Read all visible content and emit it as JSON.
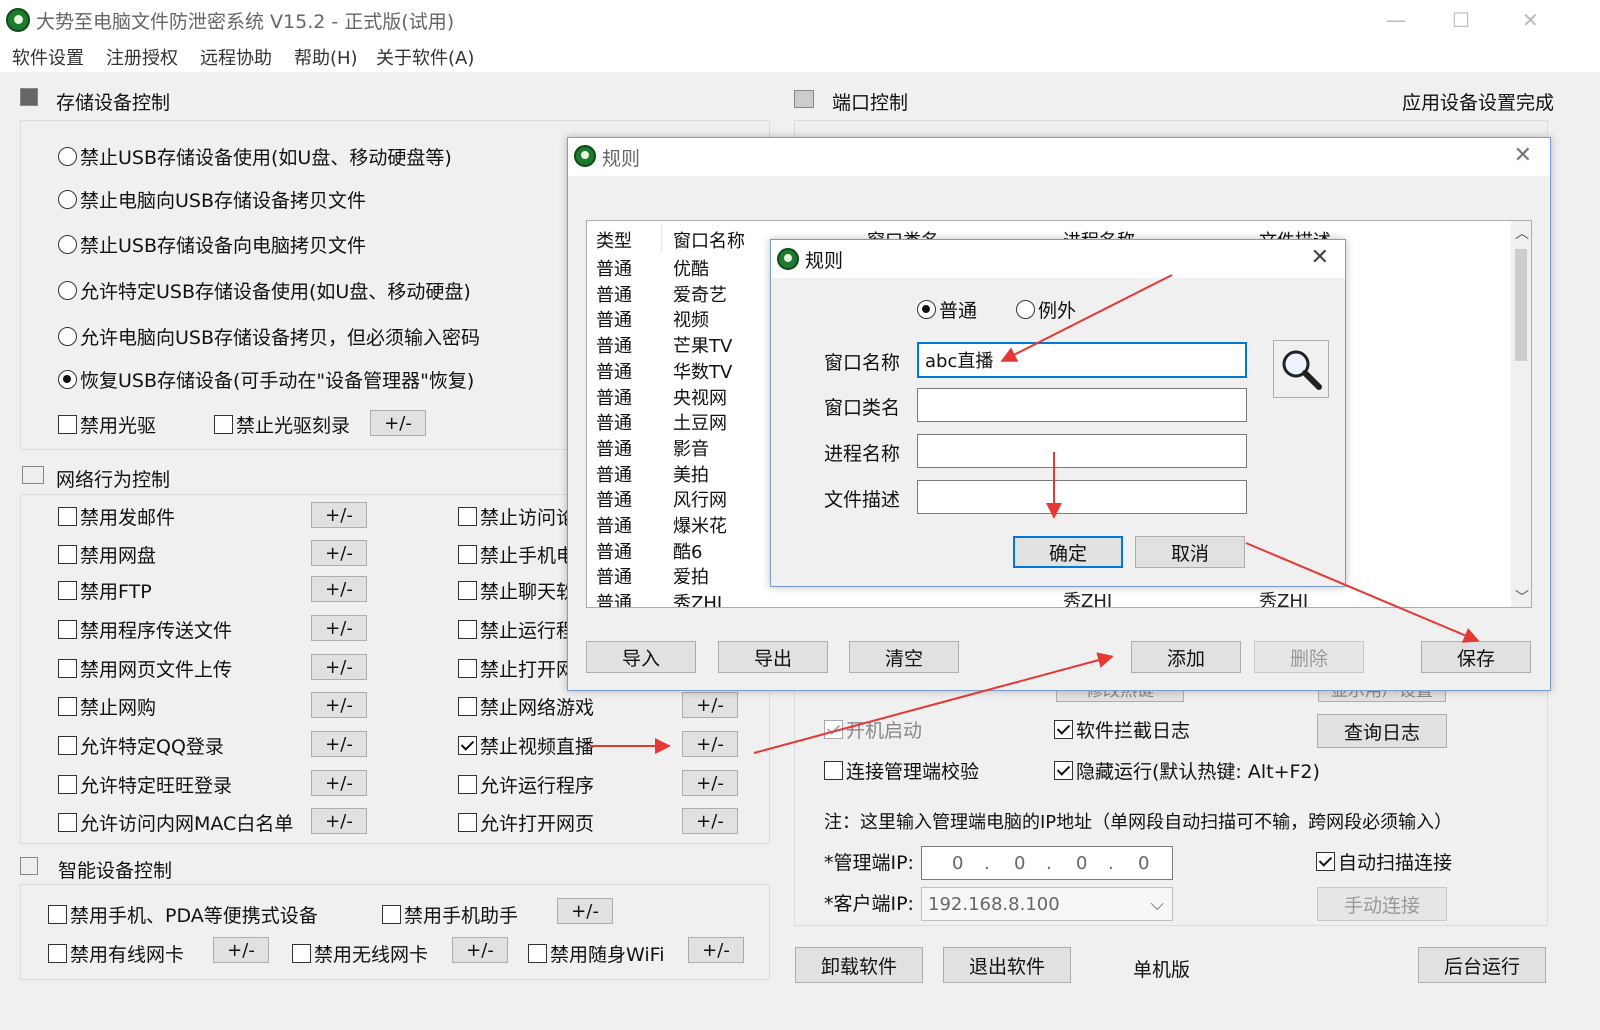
{
  "window": {
    "title": "大势至电脑文件防泄密系统 V15.2 - 正式版(试用)",
    "minimize": "—",
    "maximize": "☐",
    "close": "✕"
  },
  "menu": [
    "软件设置",
    "注册授权",
    "远程协助",
    "帮助(H)",
    "关于软件(A)"
  ],
  "storage": {
    "title": "存储设备控制",
    "options": [
      "禁止USB存储设备使用(如U盘、移动硬盘等)",
      "禁止电脑向USB存储设备拷贝文件",
      "禁止USB存储设备向电脑拷贝文件",
      "允许特定USB存储设备使用(如U盘、移动硬盘)",
      "允许电脑向USB存储设备拷贝，但必须输入密码",
      "恢复USB存储设备(可手动在\"设备管理器\"恢复)"
    ],
    "selected": 5,
    "cd_disable": "禁用光驱",
    "cd_burn": "禁止光驱刻录",
    "pm": "+/-"
  },
  "network": {
    "title": "网络行为控制",
    "left": [
      "禁用发邮件",
      "禁用网盘",
      "禁用FTP",
      "禁用程序传送文件",
      "禁用网页文件上传",
      "禁止网购",
      "允许特定QQ登录",
      "允许特定旺旺登录",
      "允许访问内网MAC白名单"
    ],
    "right": [
      "禁止访问论",
      "禁止手机电",
      "禁止聊天软",
      "禁止运行程",
      "禁止打开网",
      "禁止网络游戏",
      "禁止视频直播",
      "允许运行程序",
      "允许打开网页"
    ],
    "right_checked": 6,
    "pm": "+/-"
  },
  "smart": {
    "title": "智能设备控制",
    "phone_pda": "禁用手机、PDA等便携式设备",
    "phone_helper": "禁用手机助手",
    "wired_nic": "禁用有线网卡",
    "wireless_nic": "禁用无线网卡",
    "portable_wifi": "禁用随身WiFi",
    "pm": "+/-"
  },
  "port": {
    "title": "端口控制",
    "status": "应用设备设置完成"
  },
  "right_panel": {
    "hidden_row_btn1": "修改热键",
    "hidden_row_btn2": "显示用户设置",
    "autostart": "开机启动",
    "intercept_log": "软件拦截日志",
    "view_log": "查询日志",
    "mgmt_check": "连接管理端校验",
    "hidden_run": "隐藏运行(默认热键: Alt+F2)",
    "note": "注：这里输入管理端电脑的IP地址（单网段自动扫描可不输，跨网段必须输入）",
    "mgmt_ip_label": "*管理端IP:",
    "mgmt_ip": [
      "0",
      "0",
      "0",
      "0"
    ],
    "ip_dot": ".",
    "client_ip_label": "*客户端IP:",
    "client_ip": "192.168.8.100",
    "auto_scan": "自动扫描连接",
    "manual_connect": "手动连接"
  },
  "bottom": {
    "uninstall": "卸载软件",
    "exit": "退出软件",
    "edition": "单机版",
    "background": "后台运行"
  },
  "rules_dialog": {
    "title": "规则",
    "headers": [
      "类型",
      "窗口名称",
      "窗口类名",
      "进程名称",
      "文件描述"
    ],
    "types": [
      "普通",
      "普通",
      "普通",
      "普通",
      "普通",
      "普通",
      "普通",
      "普通",
      "普通",
      "普通",
      "普通",
      "普通",
      "普通",
      "普通"
    ],
    "names": [
      "优酷",
      "爱奇艺",
      "视频",
      "芒果TV",
      "华数TV",
      "央视网",
      "土豆网",
      "影音",
      "美拍",
      "风行网",
      "爆米花",
      "酷6",
      "爱拍",
      "秀ZHI"
    ],
    "partial_col3": "秀ZHI",
    "partial_col4": "秀ZHI",
    "buttons": {
      "import": "导入",
      "export": "导出",
      "clear": "清空",
      "add": "添加",
      "delete": "删除",
      "save": "保存"
    }
  },
  "rule_dialog": {
    "title": "规则",
    "type_normal": "普通",
    "type_exception": "例外",
    "window_name_label": "窗口名称",
    "window_name_value": "abc直播",
    "window_class_label": "窗口类名",
    "window_class_value": "",
    "process_label": "进程名称",
    "process_value": "",
    "file_desc_label": "文件描述",
    "file_desc_value": "",
    "ok": "确定",
    "cancel": "取消"
  },
  "colors": {
    "arrow": "#e53935",
    "focus_border": "#0078d7",
    "dialog_border": "#7a9ccf"
  }
}
